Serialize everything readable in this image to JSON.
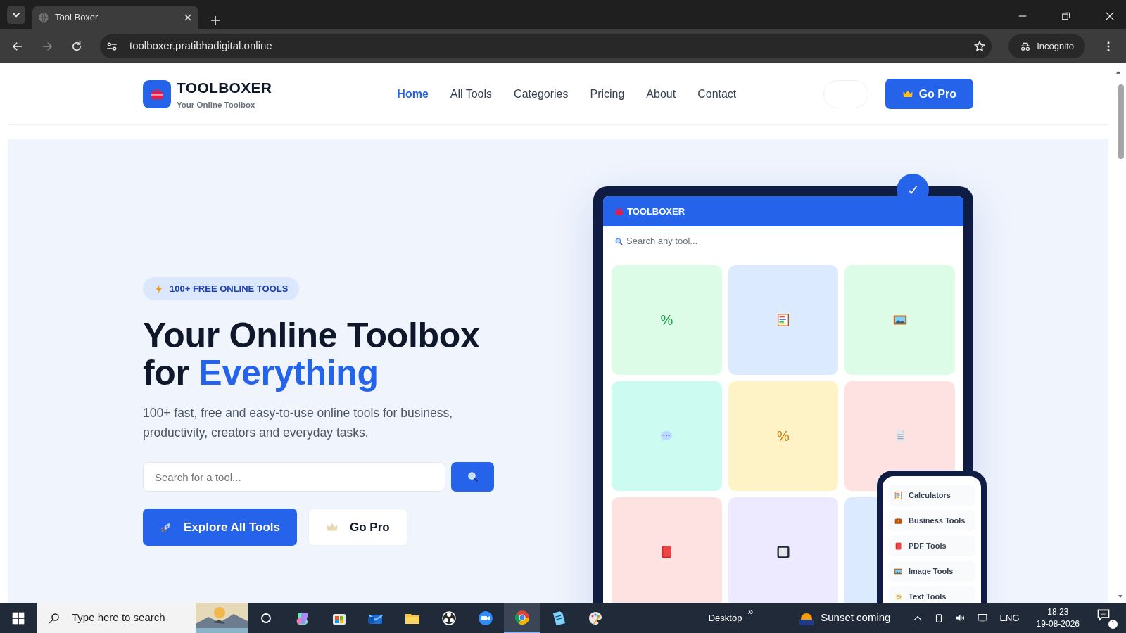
{
  "browser": {
    "tab_title": "Tool Boxer",
    "address": "toolboxer.pratibhadigital.online",
    "profile": "Incognito"
  },
  "header": {
    "brand": "TOOLBOXER",
    "tagline": "Your Online Toolbox",
    "nav": [
      {
        "label": "Home",
        "selected": true
      },
      {
        "label": "All Tools",
        "selected": false
      },
      {
        "label": "Categories",
        "selected": false
      },
      {
        "label": "Pricing",
        "selected": false
      },
      {
        "label": "About",
        "selected": false
      },
      {
        "label": "Contact",
        "selected": false
      }
    ],
    "cta": "Go Pro"
  },
  "hero": {
    "badge": "100+ FREE ONLINE TOOLS",
    "heading_line_1": "Your Online Toolbox",
    "heading_line_2_start": "for",
    "heading_highlight": "Everything",
    "description": "100+ fast, free and easy-to-use online tools for business, productivity, creators and everyday tasks.",
    "search": {
      "placeholder": "Search for a tool..."
    },
    "primary_button": "Explore All Tools",
    "secondary_button": "Go Pro"
  },
  "mockup": {
    "brand": "TOOLBOXER",
    "search_placeholder": "Search any tool...",
    "tiles": [
      {
        "kind": "text",
        "text": "%",
        "color": "#dcfce7"
      },
      {
        "kind": "abacus",
        "color": "#dbeafe"
      },
      {
        "kind": "picture",
        "color": "#dcfce7"
      },
      {
        "kind": "chat",
        "color": "#ccfbf1"
      },
      {
        "kind": "text",
        "text": "%",
        "color": "#fef3c7"
      },
      {
        "kind": "document",
        "color": "#fee2e2"
      },
      {
        "kind": "book",
        "color": "#fee2e2"
      },
      {
        "kind": "square",
        "color": "#ede9fe"
      },
      {
        "kind": "blank",
        "color": "#dbeafe"
      }
    ],
    "categories": [
      {
        "label": "Calculators",
        "kind": "abacus"
      },
      {
        "label": "Business Tools",
        "kind": "briefcase"
      },
      {
        "label": "PDF Tools",
        "kind": "book"
      },
      {
        "label": "Image Tools",
        "kind": "picture"
      },
      {
        "label": "Text Tools",
        "kind": "memo"
      }
    ]
  },
  "taskbar": {
    "search_placeholder": "Type here to search",
    "apps": [
      {
        "kind": "copilot",
        "selected": false
      },
      {
        "kind": "store",
        "selected": false
      },
      {
        "kind": "mail",
        "selected": false
      },
      {
        "kind": "folder",
        "selected": false
      },
      {
        "kind": "aperture",
        "selected": false
      },
      {
        "kind": "video",
        "selected": false
      },
      {
        "kind": "chrome",
        "selected": true
      },
      {
        "kind": "notes",
        "selected": false
      },
      {
        "kind": "paint",
        "selected": false
      }
    ],
    "desktop": "Desktop",
    "chevron": "»",
    "weather": "Sunset coming",
    "language": "ENG",
    "time": "18:23",
    "date": "19-08-2026",
    "notifications": "1"
  }
}
